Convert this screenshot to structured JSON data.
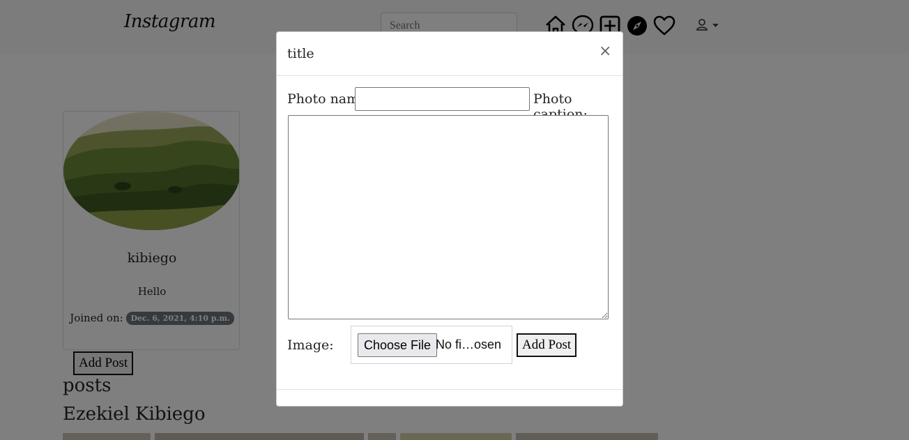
{
  "navbar": {
    "brand": "Instagram",
    "search_placeholder": "Search",
    "icons": [
      "home-icon",
      "messenger-icon",
      "new-post-icon",
      "explore-icon",
      "heart-icon",
      "user-icon"
    ]
  },
  "profile": {
    "username": "kibiego",
    "bio": "Hello",
    "joined_label": "Joined on:",
    "joined_date": "Dec. 6, 2021, 4:10 p.m.",
    "add_post_label": "Add Post"
  },
  "posts_heading": "posts",
  "author_heading": "Ezekiel Kibiego",
  "modal": {
    "title": "title",
    "close_label": "×",
    "photo_name_label": "Photo name:",
    "photo_name_value": "",
    "photo_caption_label": "Photo caption:",
    "caption_value": "",
    "image_label": "Image:",
    "choose_file_label": "Choose File",
    "file_status": "No fi…osen",
    "submit_label": "Add Post"
  },
  "colors": {
    "badge": "#6c757d",
    "navbar_bg": "#f8f9fa",
    "backdrop": "rgba(0,0,0,0.5)"
  }
}
